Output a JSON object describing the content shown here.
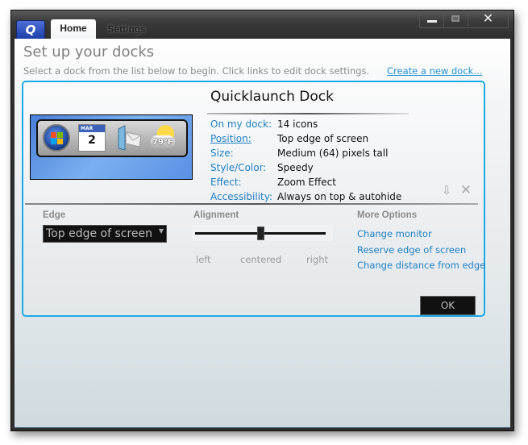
{
  "window": {
    "app_logo": "Q",
    "tabs": [
      {
        "label": "Home",
        "active": true
      },
      {
        "label": "Settings",
        "active": false
      }
    ],
    "controls": {
      "minimize": "minimize-icon",
      "maximize": "maximize-icon",
      "close": "✕"
    }
  },
  "header": {
    "title": "Set up your docks",
    "subtitle": "Select a dock from the list below to begin. Click links to edit dock settings.",
    "create_link": "Create a new dock..."
  },
  "dock": {
    "name": "Quicklaunch Dock",
    "preview": {
      "icons": [
        "windows-start-icon",
        "calendar-icon",
        "mail-icon",
        "weather-icon"
      ],
      "calendar_month": "MAR",
      "calendar_day": "2",
      "weather_temp": "79°F"
    },
    "properties": [
      {
        "label": "On my dock:",
        "value": "14 icons",
        "link": false
      },
      {
        "label": "Position:",
        "value": "Top edge of screen",
        "link": true
      },
      {
        "label": "Size:",
        "value": "Medium (64) pixels tall",
        "link": false
      },
      {
        "label": "Style/Color:",
        "value": "Speedy",
        "link": false
      },
      {
        "label": "Effect:",
        "value": "Zoom Effect",
        "link": false
      },
      {
        "label": "Accessibility:",
        "value": "Always on top & autohide",
        "link": false
      }
    ],
    "actions": {
      "download_icon": "⇩",
      "delete_icon": "✕"
    }
  },
  "settings": {
    "edge": {
      "label": "Edge",
      "selected": "Top edge of screen"
    },
    "alignment": {
      "label": "Alignment",
      "value_fraction": 0.5,
      "ticks": [
        "left",
        "centered",
        "right"
      ]
    },
    "more_options": {
      "label": "More Options",
      "links": [
        "Change monitor",
        "Reserve edge of screen",
        "Change distance from edge"
      ]
    },
    "ok_label": "OK"
  }
}
